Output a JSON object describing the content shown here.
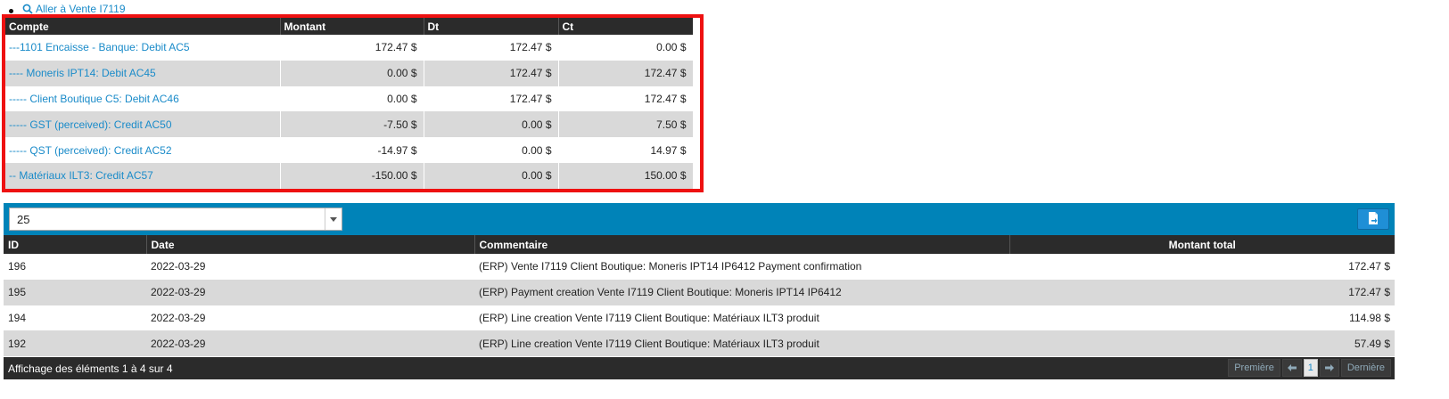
{
  "nav": {
    "link_label": "Aller à Vente I7119"
  },
  "accounts": {
    "headers": [
      "Compte",
      "Montant",
      "Dt",
      "Ct"
    ],
    "rows": [
      {
        "compte": "---1101 Encaisse - Banque: Debit AC5",
        "montant": "172.47 $",
        "dt": "172.47 $",
        "ct": "0.00 $"
      },
      {
        "compte": "---- Moneris IPT14: Debit AC45",
        "montant": "0.00 $",
        "dt": "172.47 $",
        "ct": "172.47 $"
      },
      {
        "compte": "----- Client Boutique C5: Debit AC46",
        "montant": "0.00 $",
        "dt": "172.47 $",
        "ct": "172.47 $"
      },
      {
        "compte": "----- GST (perceived): Credit AC50",
        "montant": "-7.50 $",
        "dt": "0.00 $",
        "ct": "7.50 $"
      },
      {
        "compte": "----- QST (perceived): Credit AC52",
        "montant": "-14.97 $",
        "dt": "0.00 $",
        "ct": "14.97 $"
      },
      {
        "compte": "-- Matériaux ILT3: Credit AC57",
        "montant": "-150.00 $",
        "dt": "0.00 $",
        "ct": "150.00 $"
      }
    ]
  },
  "toolbar": {
    "page_size": "25"
  },
  "entries": {
    "headers": [
      "ID",
      "Date",
      "Commentaire",
      "Montant total"
    ],
    "rows": [
      {
        "id": "196",
        "date": "2022-03-29",
        "comment": "(ERP) Vente I7119 Client Boutique: Moneris IPT14 IP6412 Payment confirmation",
        "total": "172.47 $"
      },
      {
        "id": "195",
        "date": "2022-03-29",
        "comment": "(ERP) Payment creation Vente I7119 Client Boutique: Moneris IPT14 IP6412",
        "total": "172.47 $"
      },
      {
        "id": "194",
        "date": "2022-03-29",
        "comment": "(ERP) Line creation Vente I7119 Client Boutique: Matériaux ILT3 produit",
        "total": "114.98 $"
      },
      {
        "id": "192",
        "date": "2022-03-29",
        "comment": "(ERP) Line creation Vente I7119 Client Boutique: Matériaux ILT3 produit",
        "total": "57.49 $"
      }
    ]
  },
  "footer": {
    "info": "Affichage des éléments 1 à 4 sur 4",
    "first": "Première",
    "current_page": "1",
    "last": "Dernière"
  },
  "colors": {
    "accent": "#0083b8",
    "link": "#1a8bc9",
    "highlight": "#ee1111",
    "header": "#2b2b2b"
  }
}
